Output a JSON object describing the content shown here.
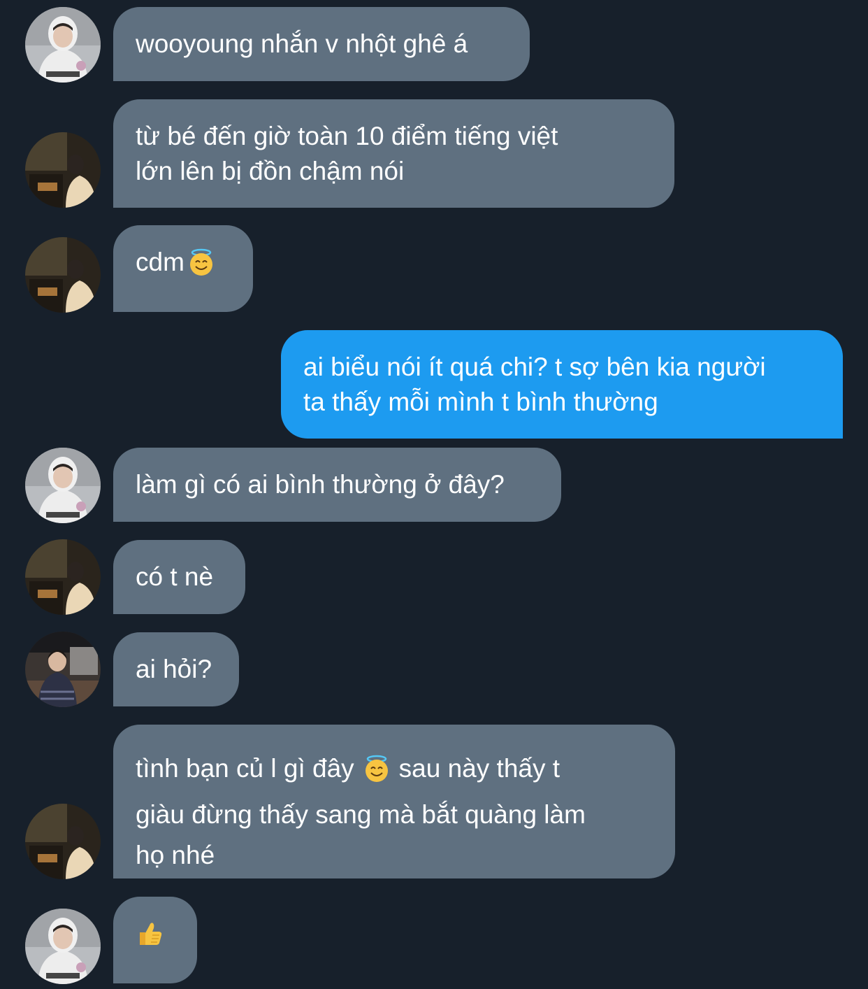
{
  "messages": [
    {
      "direction": "in",
      "avatar": "avatar-hoodie",
      "lines": [
        "wooyoung nhắn v nhột ghê á"
      ]
    },
    {
      "direction": "in",
      "avatar": "avatar-night",
      "lines": [
        "từ bé đến giờ toàn 10 điểm tiếng việt",
        "lớn lên bị đồn chậm nói"
      ]
    },
    {
      "direction": "in",
      "avatar": "avatar-night",
      "text": "cdm",
      "emoji": "😇"
    },
    {
      "direction": "out",
      "lines": [
        "ai biểu nói ít quá chi? t sợ bên kia người",
        "ta thấy mỗi mình t bình thường"
      ]
    },
    {
      "direction": "in",
      "avatar": "avatar-hoodie",
      "lines": [
        "làm gì có ai bình thường ở đây?"
      ]
    },
    {
      "direction": "in",
      "avatar": "avatar-night",
      "lines": [
        "có t nè"
      ]
    },
    {
      "direction": "in",
      "avatar": "avatar-cafe",
      "lines": [
        "ai hỏi?"
      ]
    },
    {
      "direction": "in",
      "avatar": "avatar-night",
      "line1_before": "tình bạn củ l gì đây",
      "emoji": "😇",
      "line1_after": "sau này thấy t",
      "lines_rest": [
        "giàu đừng thấy sang mà bắt quàng làm",
        "họ nhé"
      ]
    },
    {
      "direction": "in",
      "avatar": "avatar-hoodie",
      "emoji": "👍"
    }
  ],
  "colors": {
    "background": "#17202b",
    "incoming_bubble": "#5f7080",
    "outgoing_bubble": "#1d9bf0",
    "text": "#ffffff"
  }
}
